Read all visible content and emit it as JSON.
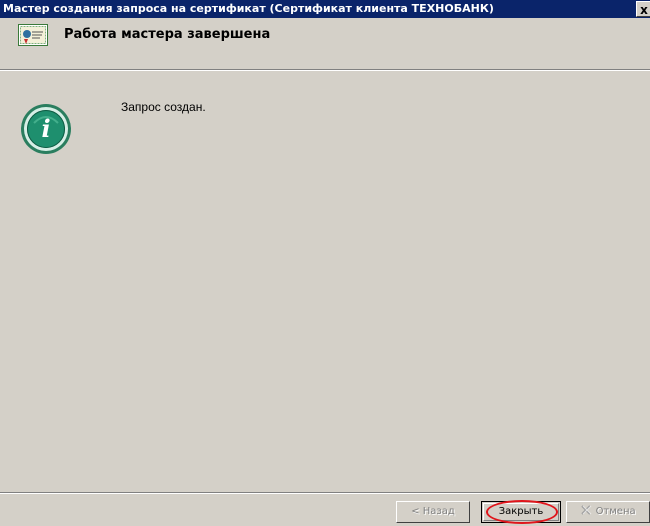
{
  "window": {
    "title": "Мастер создания запроса на сертификат (Сертификат клиента ТЕХНОБАНК)",
    "close_label": "x"
  },
  "header": {
    "title": "Работа мастера завершена",
    "icon": "certificate-icon"
  },
  "content": {
    "icon": "info-icon",
    "message": "Запрос создан."
  },
  "footer": {
    "back_label": "< Назад",
    "close_label": "Закрыть",
    "cancel_label": "Отмена",
    "cancel_icon": "cancel-x-icon"
  },
  "colors": {
    "titlebar": "#0a246a",
    "window_bg": "#d4d0c8",
    "info_icon_green": "#1e8f6e",
    "highlight": "#e0151b"
  }
}
